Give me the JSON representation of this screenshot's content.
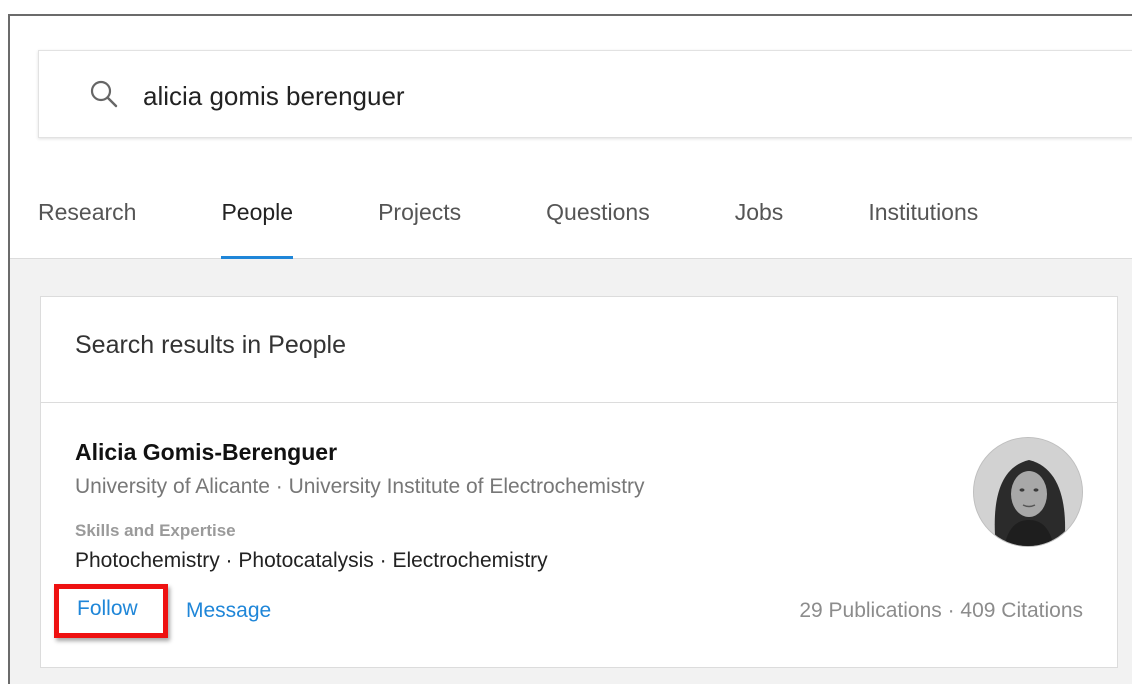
{
  "search": {
    "query": "alicia gomis berenguer",
    "icon": "search-icon"
  },
  "tabs": [
    {
      "label": "Research",
      "active": false
    },
    {
      "label": "People",
      "active": true
    },
    {
      "label": "Projects",
      "active": false
    },
    {
      "label": "Questions",
      "active": false
    },
    {
      "label": "Jobs",
      "active": false
    },
    {
      "label": "Institutions",
      "active": false
    }
  ],
  "results": {
    "header": "Search results in People",
    "person": {
      "name": "Alicia Gomis-Berenguer",
      "affiliation": "University of Alicante · University Institute of Electrochemistry",
      "skills_label": "Skills and Expertise",
      "skills": "Photochemistry · Photocatalysis · Electrochemistry",
      "follow_label": "Follow",
      "message_label": "Message",
      "stats": "29 Publications · 409 Citations"
    }
  },
  "colors": {
    "link": "#1f86d8",
    "highlight": "#ee1111",
    "tab_indicator": "#1f86d8"
  }
}
